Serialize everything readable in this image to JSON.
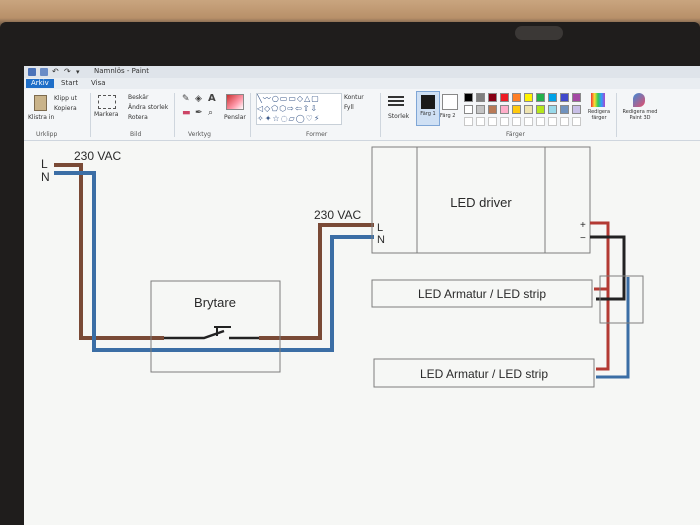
{
  "window": {
    "title": "Namnlös - Paint"
  },
  "tabs": [
    {
      "label": "Arkiv"
    },
    {
      "label": "Start"
    },
    {
      "label": "Visa"
    }
  ],
  "ribbon": {
    "clipboard": {
      "paste": "Klistra in",
      "cut": "Klipp ut",
      "copy": "Kopiera",
      "group": "Urklipp"
    },
    "image": {
      "select": "Markera",
      "crop": "Beskär",
      "resize": "Ändra storlek",
      "rotate": "Rotera",
      "group": "Bild"
    },
    "tools": {
      "group": "Verktyg"
    },
    "brushes": {
      "label": "Penslar"
    },
    "shapes": {
      "outline": "Kontur",
      "fill": "Fyll",
      "group": "Former"
    },
    "size": {
      "label": "Storlek"
    },
    "color1": {
      "label": "Färg 1"
    },
    "color2": {
      "label": "Färg 2"
    },
    "colors": {
      "group": "Färger",
      "edit": "Redigera färger",
      "paint3d": "Redigera med Paint 3D"
    },
    "palette": [
      "#000000",
      "#7f7f7f",
      "#880015",
      "#ed1c24",
      "#ff7f27",
      "#fff200",
      "#22b14c",
      "#00a2e8",
      "#3f48cc",
      "#a349a4",
      "#ffffff",
      "#c3c3c3",
      "#b97a57",
      "#ffaec9",
      "#ffc90e",
      "#efe4b0",
      "#b5e61d",
      "#99d9ea",
      "#7092be",
      "#c8bfe7"
    ]
  },
  "diagram": {
    "supply": {
      "line": "L",
      "neutral": "N",
      "voltage": "230 VAC"
    },
    "switch": {
      "label": "Brytare"
    },
    "driver": {
      "label": "LED driver",
      "input_voltage": "230 VAC",
      "in_l": "L",
      "in_n": "N",
      "out_plus": "+",
      "out_minus": "−"
    },
    "fixtures": [
      {
        "label": "LED Armatur / LED strip"
      },
      {
        "label": "LED Armatur / LED strip"
      }
    ],
    "wire_colors": {
      "live": "#7a4a36",
      "neutral": "#3b6ea5",
      "plus": "#b33a33",
      "minus": "#222222"
    }
  }
}
